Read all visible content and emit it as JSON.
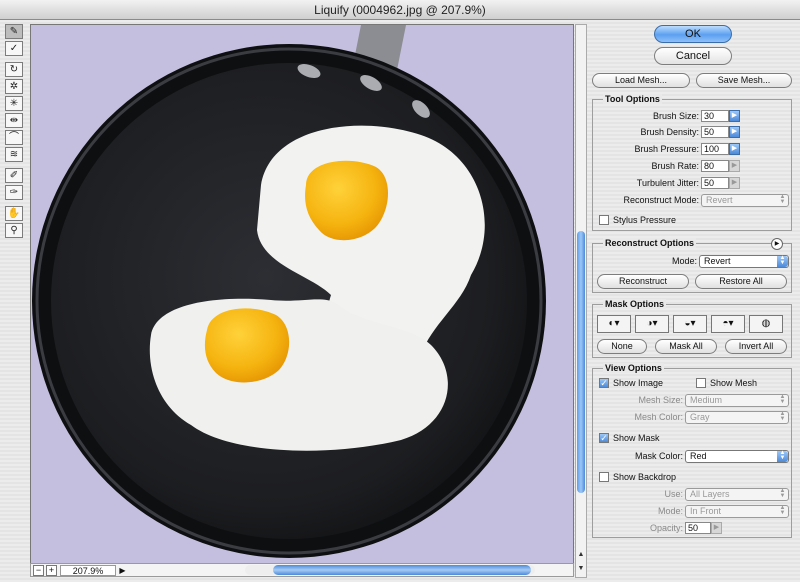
{
  "window": {
    "title": "Liquify (0004962.jpg @ 207.9%)"
  },
  "tools": [
    {
      "name": "forward-warp-tool-icon",
      "glyph": "✎",
      "active": true
    },
    {
      "name": "reconstruct-tool-icon",
      "glyph": "✓"
    },
    {
      "name": "twirl-tool-icon",
      "glyph": "↻"
    },
    {
      "name": "pucker-tool-icon",
      "glyph": "✲"
    },
    {
      "name": "bloat-tool-icon",
      "glyph": "✳"
    },
    {
      "name": "push-left-tool-icon",
      "glyph": "⇹"
    },
    {
      "name": "mirror-tool-icon",
      "glyph": "⌒"
    },
    {
      "name": "turbulence-tool-icon",
      "glyph": "≋"
    },
    {
      "name": "freeze-mask-tool-icon",
      "glyph": "✐"
    },
    {
      "name": "thaw-mask-tool-icon",
      "glyph": "✑"
    },
    {
      "name": "hand-tool-icon",
      "glyph": "✋"
    },
    {
      "name": "zoom-tool-icon",
      "glyph": "⚲"
    }
  ],
  "status": {
    "zoom_out": "−",
    "zoom_in": "+",
    "zoom": "207.9%",
    "zoom_arrow": "▶"
  },
  "buttons": {
    "ok": "OK",
    "cancel": "Cancel",
    "load_mesh": "Load Mesh...",
    "save_mesh": "Save Mesh..."
  },
  "tool_options": {
    "title": "Tool Options",
    "brush_size_label": "Brush Size:",
    "brush_size": "30",
    "brush_density_label": "Brush Density:",
    "brush_density": "50",
    "brush_pressure_label": "Brush Pressure:",
    "brush_pressure": "100",
    "brush_rate_label": "Brush Rate:",
    "brush_rate": "80",
    "turbulent_jitter_label": "Turbulent Jitter:",
    "turbulent_jitter": "50",
    "reconstruct_mode_label": "Reconstruct Mode:",
    "reconstruct_mode": "Revert",
    "stylus_pressure": "Stylus Pressure"
  },
  "reconstruct_options": {
    "title": "Reconstruct Options",
    "mode_label": "Mode:",
    "mode": "Revert",
    "reconstruct": "Reconstruct",
    "restore_all": "Restore All"
  },
  "mask_options": {
    "title": "Mask Options",
    "none": "None",
    "mask_all": "Mask All",
    "invert_all": "Invert All"
  },
  "view_options": {
    "title": "View Options",
    "show_image": "Show Image",
    "show_mesh": "Show Mesh",
    "mesh_size_label": "Mesh Size:",
    "mesh_size": "Medium",
    "mesh_color_label": "Mesh Color:",
    "mesh_color": "Gray",
    "show_mask": "Show Mask",
    "mask_color_label": "Mask Color:",
    "mask_color": "Red",
    "show_backdrop": "Show Backdrop",
    "use_label": "Use:",
    "use": "All Layers",
    "mode_label": "Mode:",
    "mode": "In Front",
    "opacity_label": "Opacity:",
    "opacity": "50"
  }
}
